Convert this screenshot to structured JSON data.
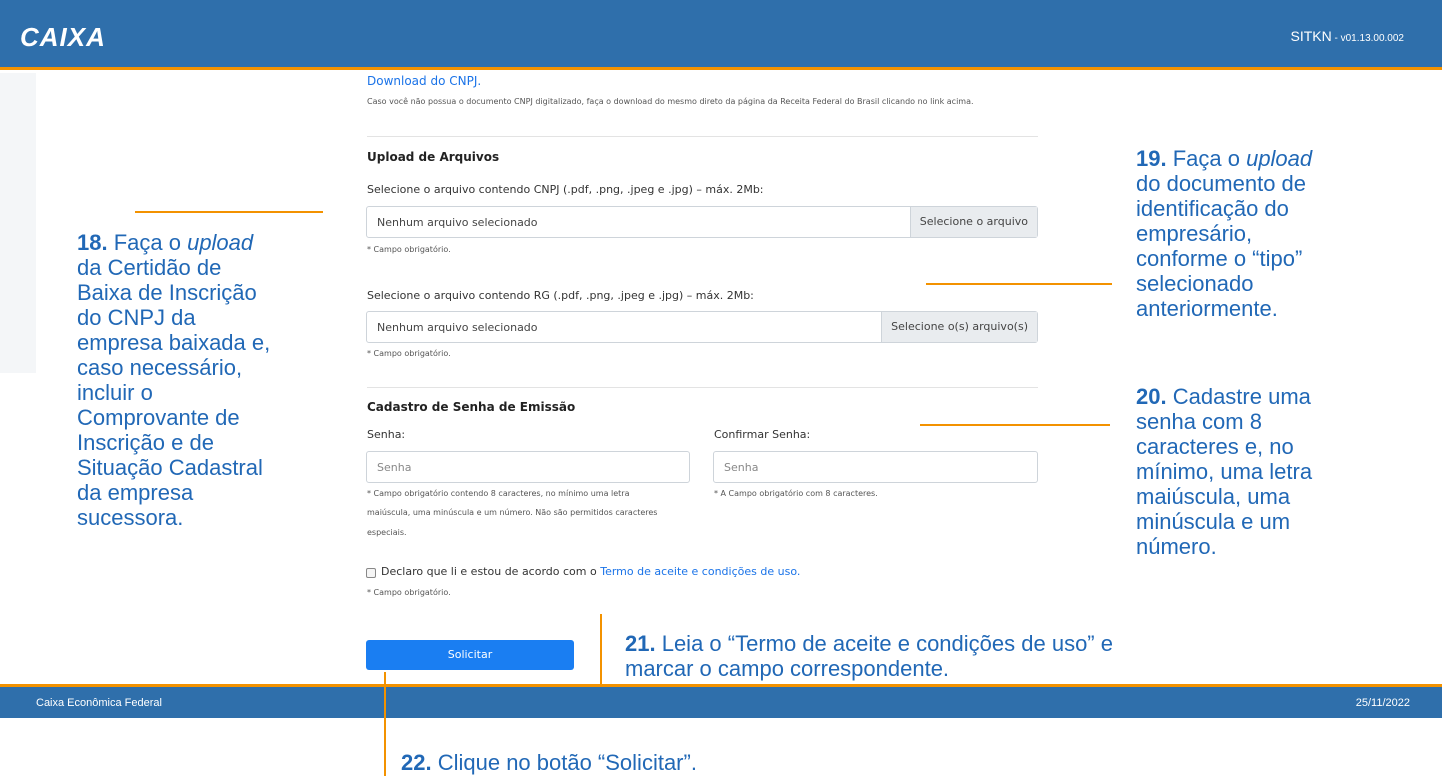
{
  "header": {
    "logo": "CAIXA",
    "system": "SITKN",
    "version": " - v01.13.00.002"
  },
  "download": {
    "link": "Download do CNPJ.",
    "note": "Caso você não possua o documento CNPJ digitalizado, faça o download do mesmo direto da página da Receita Federal do Brasil clicando no link acima."
  },
  "upload": {
    "title": "Upload de Arquivos",
    "cnpj_label": "Selecione o arquivo contendo CNPJ (.pdf, .png, .jpeg e .jpg) – máx. 2Mb:",
    "cnpj_value": "Nenhum arquivo selecionado",
    "cnpj_button": "Selecione o arquivo",
    "cnpj_help": "* Campo obrigatório.",
    "rg_label": "Selecione o arquivo contendo RG (.pdf, .png, .jpeg e .jpg) – máx. 2Mb:",
    "rg_value": "Nenhum arquivo selecionado",
    "rg_button": "Selecione o(s) arquivo(s)",
    "rg_help": "* Campo obrigatório."
  },
  "password": {
    "title": "Cadastro de Senha de Emissão",
    "senha_label": "Senha:",
    "senha_placeholder": "Senha",
    "senha_help_1": "* Campo obrigatório contendo 8 caracteres, no mínimo uma letra",
    "senha_help_2": "maiúscula, uma minúscula e um número. Não são permitidos caracteres",
    "senha_help_3": "especiais.",
    "confirm_label": "Confirmar Senha:",
    "confirm_placeholder": "Senha",
    "confirm_help": "* A Campo obrigatório com 8 caracteres."
  },
  "terms": {
    "text": "Declaro que li e estou de acordo com o ",
    "link": "Termo de aceite e condições de uso.",
    "help": "* Campo obrigatório."
  },
  "submit": "Solicitar",
  "footer": {
    "left": "Caixa Econômica Federal",
    "right": "25/11/2022"
  },
  "annotations": {
    "a18": {
      "num": "18.",
      "l1": " Faça o ",
      "l1i": "upload",
      "lines": [
        "da Certidão de",
        "Baixa de Inscrição",
        "do CNPJ da",
        "empresa baixada e,",
        "caso necessário,",
        "incluir o",
        "Comprovante de",
        "Inscrição e de",
        "Situação Cadastral",
        "da empresa",
        "sucessora."
      ]
    },
    "a19": {
      "num": "19.",
      "l1": " Faça o ",
      "l1i": "upload",
      "lines": [
        "do documento de",
        "identificação do",
        "empresário,",
        "conforme o “tipo”",
        "selecionado",
        "anteriormente."
      ]
    },
    "a20": {
      "num": "20.",
      "l1": " Cadastre uma",
      "lines": [
        "senha com 8",
        "caracteres e, no",
        "mínimo, uma letra",
        "maiúscula, uma",
        "minúscula e um",
        "número."
      ]
    },
    "a21": {
      "num": "21.",
      "l1": " Leia o “Termo de aceite e condições de uso” e",
      "l2": "marcar o campo correspondente."
    },
    "a22": {
      "num": "22.",
      "l1": " Clique no botão “Solicitar”."
    }
  }
}
